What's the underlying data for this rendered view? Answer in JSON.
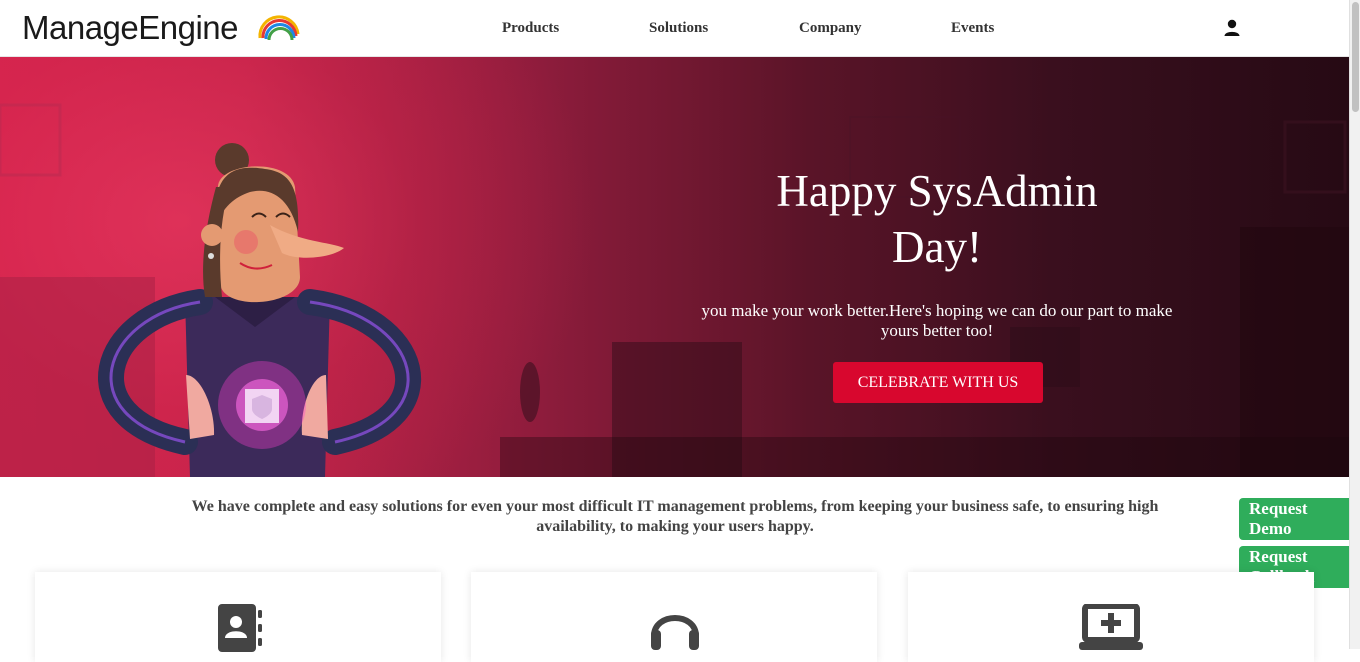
{
  "brand": {
    "name": "ManageEngine"
  },
  "nav": {
    "items": [
      {
        "label": "Products"
      },
      {
        "label": "Solutions"
      },
      {
        "label": "Company"
      },
      {
        "label": "Events"
      }
    ],
    "user_icon": "user-icon"
  },
  "hero": {
    "title": "Happy SysAdmin Day!",
    "subtitle": "you make your work better.Here's hoping we can do our part to make yours better too!",
    "button_label": "CELEBRATE WITH US",
    "button_color": "#d8072e"
  },
  "intro": {
    "text": "We have complete and easy solutions for even your most difficult IT management problems, from keeping your business safe, to ensuring high availability, to making your users happy."
  },
  "floating": {
    "request_demo": "Request Demo",
    "request_callback": "Request Callback",
    "color": "#2fad5b"
  },
  "cards": [
    {
      "icon": "contact-book-icon"
    },
    {
      "icon": "headset-icon"
    },
    {
      "icon": "laptop-plus-icon"
    }
  ]
}
